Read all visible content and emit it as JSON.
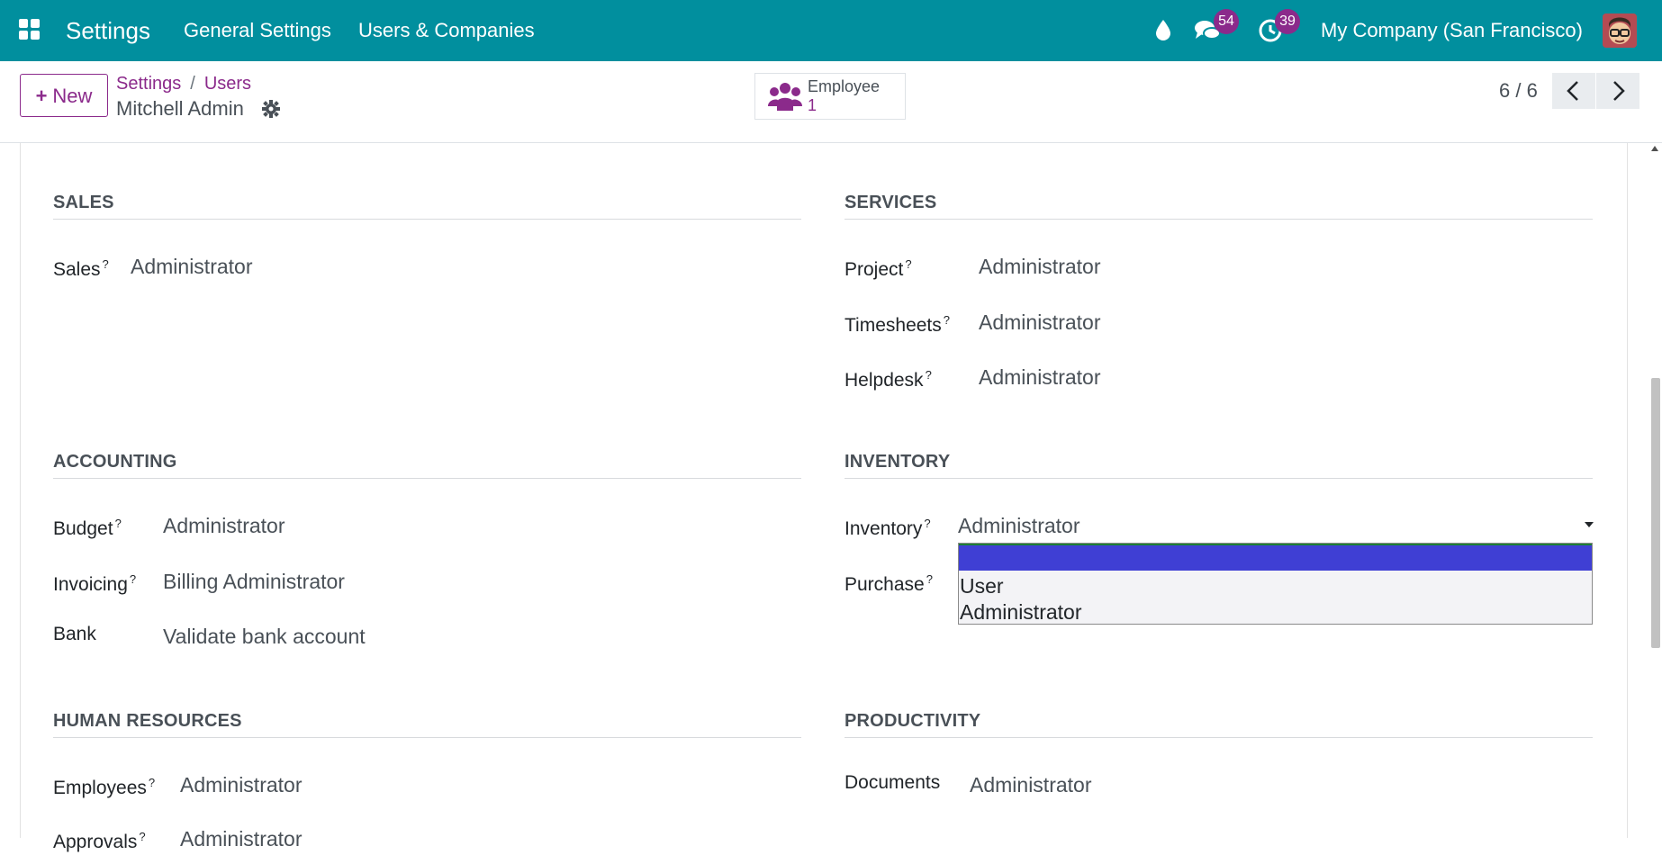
{
  "navbar": {
    "app_title": "Settings",
    "menu": [
      "General Settings",
      "Users & Companies"
    ],
    "messages_count": "54",
    "activities_count": "39",
    "company": "My Company (San Francisco)",
    "icons": [
      "apps-grid-icon",
      "water-drop-icon",
      "chat-icon",
      "clock-icon",
      "avatar"
    ]
  },
  "control": {
    "new_label": "New",
    "breadcrumb": [
      "Settings",
      "Users"
    ],
    "breadcrumb_sep": "/",
    "record_name": "Mitchell Admin",
    "smart_button": {
      "label": "Employee",
      "value": "1"
    },
    "pager": "6 / 6"
  },
  "sections": {
    "sales": {
      "title": "SALES",
      "rows": [
        {
          "label": "Sales",
          "help": "?",
          "value": "Administrator"
        }
      ]
    },
    "services": {
      "title": "SERVICES",
      "rows": [
        {
          "label": "Project",
          "help": "?",
          "value": "Administrator"
        },
        {
          "label": "Timesheets",
          "help": "?",
          "value": "Administrator"
        },
        {
          "label": "Helpdesk",
          "help": "?",
          "value": "Administrator"
        }
      ]
    },
    "accounting": {
      "title": "ACCOUNTING",
      "rows": [
        {
          "label": "Budget",
          "help": "?",
          "value": "Administrator"
        },
        {
          "label": "Invoicing",
          "help": "?",
          "value": "Billing Administrator"
        },
        {
          "label": "Bank",
          "help": "",
          "value": "Validate bank account"
        }
      ]
    },
    "inventory": {
      "title": "INVENTORY",
      "rows": [
        {
          "label": "Inventory",
          "help": "?",
          "value": "Administrator"
        },
        {
          "label": "Purchase",
          "help": "?",
          "value": ""
        }
      ]
    },
    "human_resources": {
      "title": "HUMAN RESOURCES",
      "rows": [
        {
          "label": "Employees",
          "help": "?",
          "value": "Administrator"
        },
        {
          "label": "Approvals",
          "help": "?",
          "value": "Administrator"
        }
      ]
    },
    "productivity": {
      "title": "PRODUCTIVITY",
      "rows": [
        {
          "label": "Documents",
          "help": "",
          "value": "Administrator"
        }
      ]
    }
  },
  "dropdown": {
    "options": [
      "",
      "User",
      "Administrator"
    ],
    "highlighted": 0
  },
  "colors": {
    "navbar": "#018f9e",
    "brand": "#8b2a8b",
    "highlight": "#3f3fd4"
  }
}
